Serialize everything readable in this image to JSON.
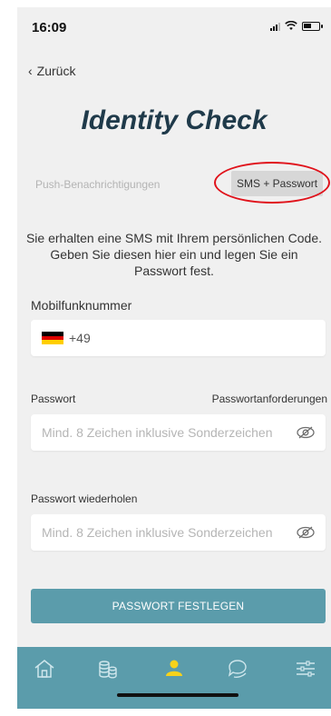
{
  "status_bar": {
    "time": "16:09"
  },
  "nav": {
    "back_label": "Zurück"
  },
  "title": "Identity Check",
  "toggle": {
    "options": [
      "Push-Benachrichtigungen",
      "SMS + Passwort"
    ],
    "selected": "SMS + Passwort"
  },
  "info_text": "Sie erhalten eine SMS mit Ihrem persönlichen Code. Geben Sie diesen hier ein und legen Sie ein Passwort fest.",
  "phone": {
    "label": "Mobilfunknummer",
    "prefix": "+49",
    "country_flag": "flag-germany-icon"
  },
  "password": {
    "label": "Passwort",
    "requirements_link": "Passwortanforderungen",
    "placeholder": "Mind. 8 Zeichen inklusive Sonderzeichen",
    "value": ""
  },
  "password_repeat": {
    "label": "Passwort wiederholen",
    "placeholder": "Mind. 8 Zeichen inklusive Sonderzeichen",
    "value": ""
  },
  "submit_label": "PASSWORT FESTLEGEN",
  "tabbar": {
    "items": [
      "home-icon",
      "coins-icon",
      "profile-icon",
      "chat-icon",
      "settings-sliders-icon"
    ],
    "active": "profile-icon"
  },
  "colors": {
    "accent": "#5b9cab",
    "active_tab": "#f7d21a",
    "title": "#1f3a4a",
    "highlight_ring": "#e0121b",
    "background": "#f0f0f0"
  }
}
